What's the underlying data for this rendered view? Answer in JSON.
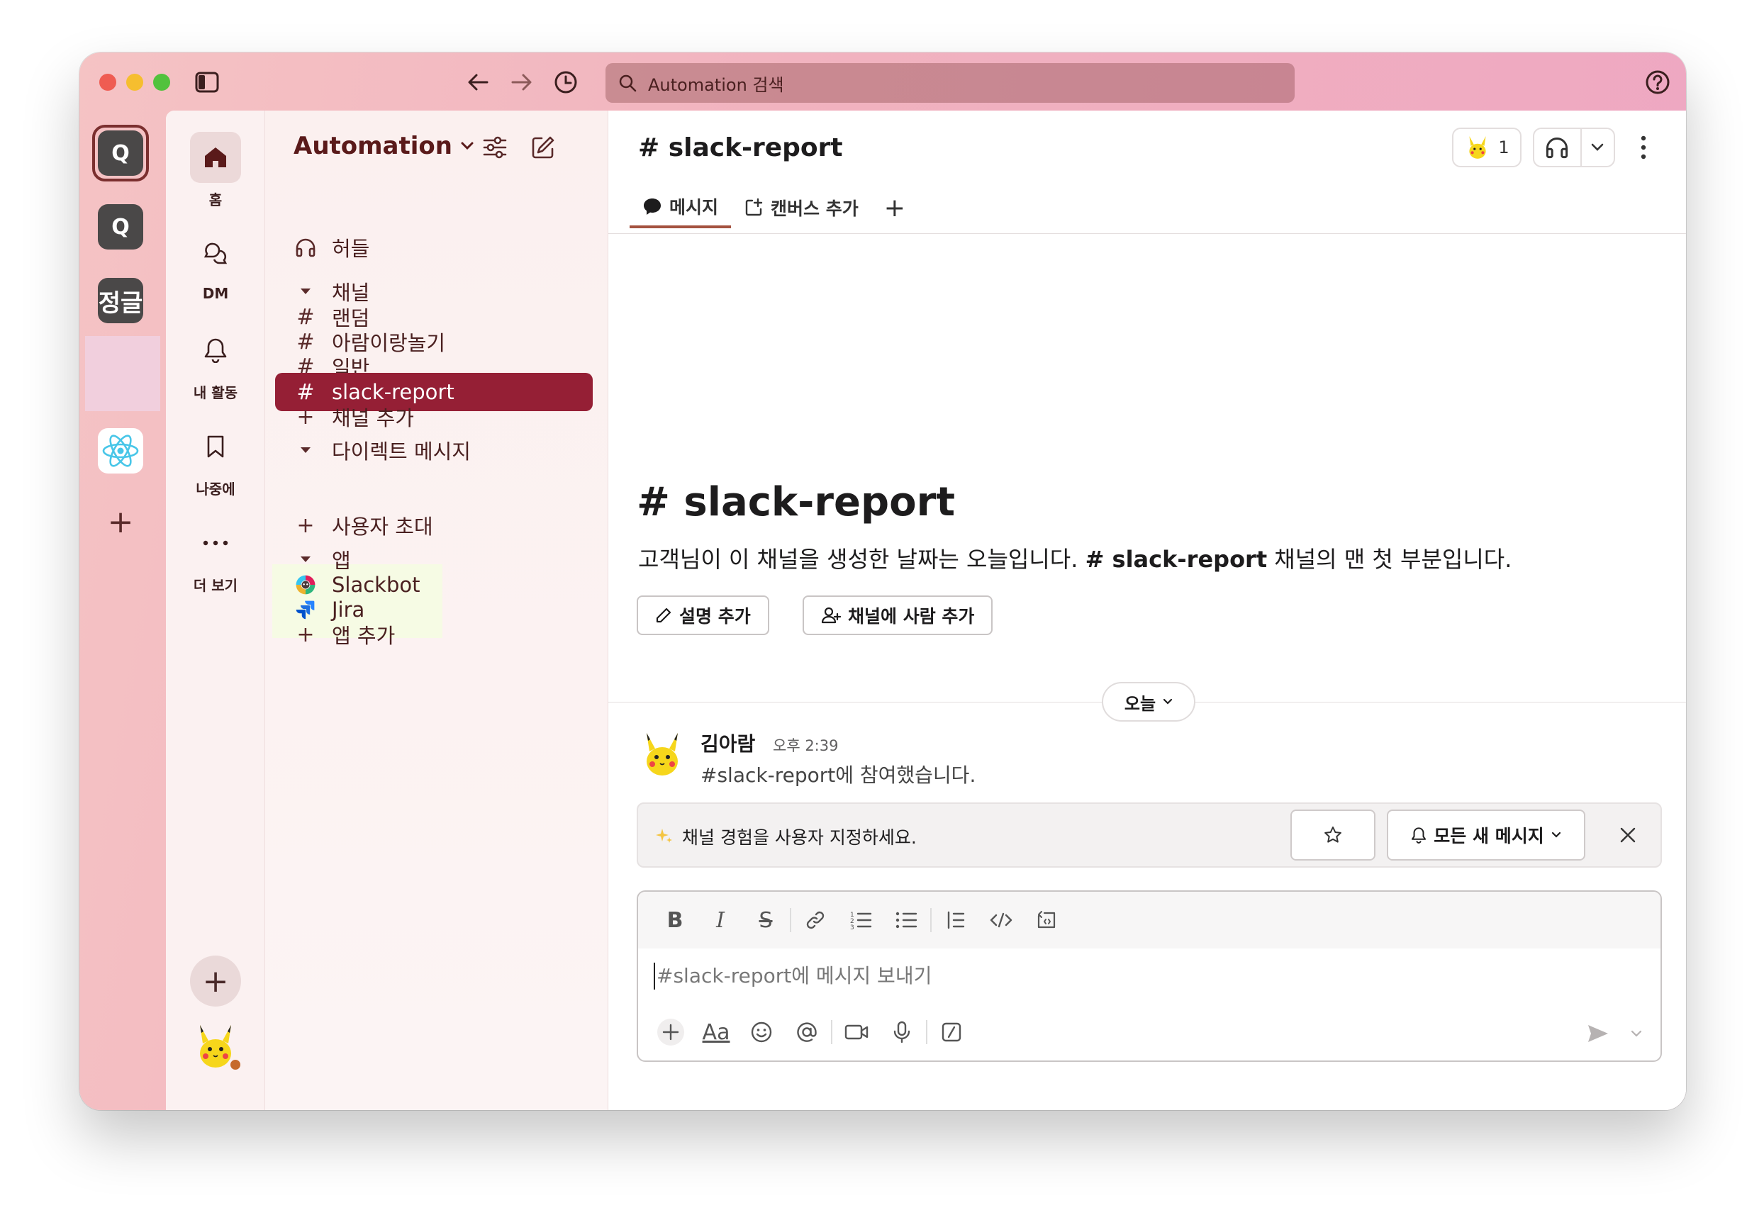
{
  "search": {
    "placeholder": "Automation 검색"
  },
  "workspaces": [
    {
      "letter": "Q"
    },
    {
      "letter": "Q"
    },
    {
      "letter": "정글"
    }
  ],
  "nav": {
    "home": "홈",
    "dm": "DM",
    "activity": "내 활동",
    "later": "나중에",
    "more": "더 보기"
  },
  "sidebar": {
    "workspace_name": "Automation",
    "huddle": "허들",
    "channels_header": "채널",
    "channels": [
      "랜덤",
      "아람이랑놀기",
      "일반",
      "slack-report"
    ],
    "add_channel": "채널 추가",
    "dm_header": "다이렉트 메시지",
    "invite_users": "사용자 초대",
    "apps_header": "앱",
    "apps": [
      "Slackbot",
      "Jira"
    ],
    "add_app": "앱 추가"
  },
  "channel": {
    "name": "slack-report",
    "member_count": "1",
    "tabs": {
      "messages": "메시지",
      "add_canvas": "캔버스 추가"
    }
  },
  "intro": {
    "title": "slack-report",
    "text_before": "고객님이 이 채널을 생성한 날짜는 오늘입니다.",
    "channel_name": "slack-report",
    "text_after": "채널의 맨 첫 부분입니다.",
    "add_description": "설명 추가",
    "add_people": "채널에 사람 추가"
  },
  "date_divider": "오늘",
  "message": {
    "author": "김아람",
    "time": "오후 2:39",
    "text": "#slack-report에 참여했습니다."
  },
  "banner": {
    "text": "채널 경험을 사용자 지정하세요.",
    "notif_label": "모든 새 메시지"
  },
  "composer": {
    "placeholder": "#slack-report에 메시지 보내기"
  },
  "colors": {
    "accent": "#951f35",
    "sidebar_text": "#4a2020",
    "window_gradient_start": "#f5c3c4",
    "window_gradient_end": "#eea6c2"
  }
}
